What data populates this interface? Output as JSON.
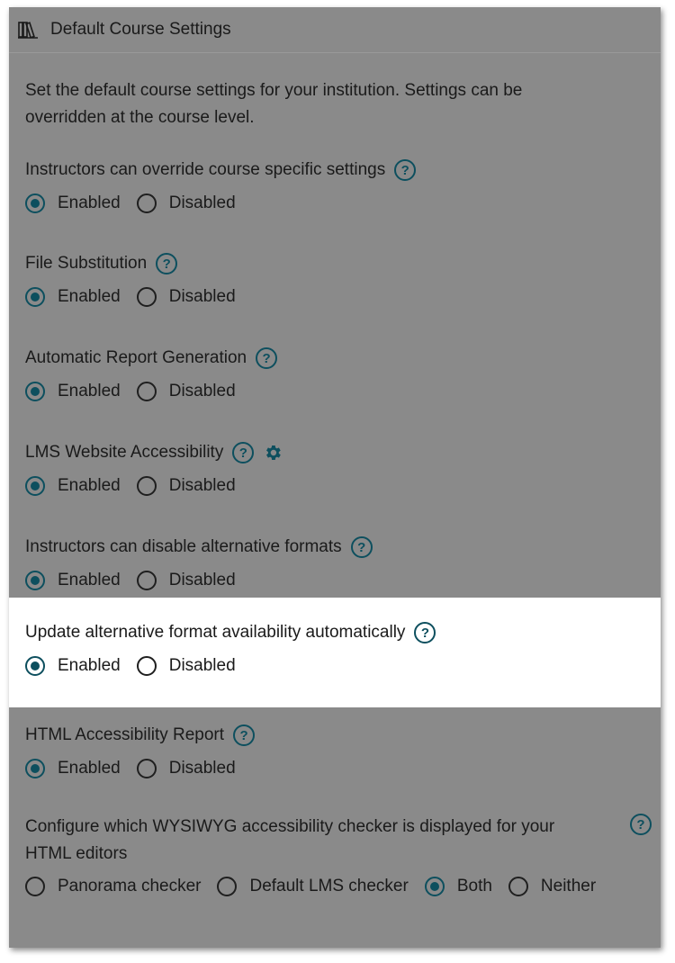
{
  "header": {
    "title": "Default Course Settings",
    "icon": "books-icon"
  },
  "intro": "Set the default course settings for your institution. Settings can be overridden at the course level.",
  "colors": {
    "accent": "#0d4f5e",
    "panel_bg": "#8a8a8a",
    "highlight_bg": "#ffffff"
  },
  "settings": [
    {
      "label": "Instructors can override course specific settings",
      "options": [
        "Enabled",
        "Disabled"
      ],
      "selected": "Enabled"
    },
    {
      "label": "File Substitution",
      "options": [
        "Enabled",
        "Disabled"
      ],
      "selected": "Enabled"
    },
    {
      "label": "Automatic Report Generation",
      "options": [
        "Enabled",
        "Disabled"
      ],
      "selected": "Enabled"
    },
    {
      "label": "LMS Website Accessibility",
      "options": [
        "Enabled",
        "Disabled"
      ],
      "selected": "Enabled",
      "has_gear": true
    },
    {
      "label": "Instructors can disable alternative formats",
      "options": [
        "Enabled",
        "Disabled"
      ],
      "selected": "Enabled"
    },
    {
      "label": "Update alternative format availability automatically",
      "options": [
        "Enabled",
        "Disabled"
      ],
      "selected": "Enabled",
      "highlighted": true
    },
    {
      "label": "HTML Accessibility Report",
      "options": [
        "Enabled",
        "Disabled"
      ],
      "selected": "Enabled"
    }
  ],
  "wysiwyg": {
    "label": "Configure which WYSIWYG accessibility checker is displayed for your HTML editors",
    "options": [
      "Panorama checker",
      "Default LMS checker",
      "Both",
      "Neither"
    ],
    "selected": "Both"
  }
}
